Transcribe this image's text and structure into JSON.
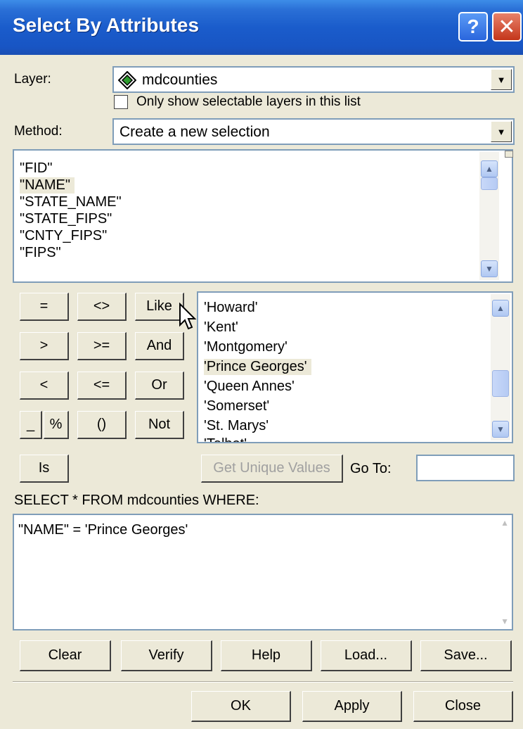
{
  "window": {
    "title": "Select By Attributes"
  },
  "layer": {
    "label": "Layer:",
    "value": "mdcounties",
    "only_selectable_label": "Only show selectable layers in this list"
  },
  "method": {
    "label": "Method:",
    "value": "Create a new selection"
  },
  "fields": [
    "\"FID\"",
    "\"NAME\"",
    "\"STATE_NAME\"",
    "\"STATE_FIPS\"",
    "\"CNTY_FIPS\"",
    "\"FIPS\""
  ],
  "operators": {
    "eq": "=",
    "ne": "<>",
    "like": "Like",
    "gt": ">",
    "ge": ">=",
    "and": "And",
    "lt": "<",
    "le": "<=",
    "or": "Or",
    "underscore": "_",
    "percent": "%",
    "parens": "()",
    "not": "Not",
    "is": "Is"
  },
  "values": [
    "'Howard'",
    "'Kent'",
    "'Montgomery'",
    "'Prince Georges'",
    "'Queen Annes'",
    "'Somerset'",
    "'St. Marys'",
    "'Talbot'"
  ],
  "get_unique_label": "Get Unique Values",
  "goto_label": "Go To:",
  "sql_label": "SELECT * FROM mdcounties WHERE:",
  "expression": "\"NAME\" = 'Prince Georges'",
  "buttons": {
    "clear": "Clear",
    "verify": "Verify",
    "help": "Help",
    "load": "Load...",
    "save": "Save...",
    "ok": "OK",
    "apply": "Apply",
    "close": "Close"
  }
}
